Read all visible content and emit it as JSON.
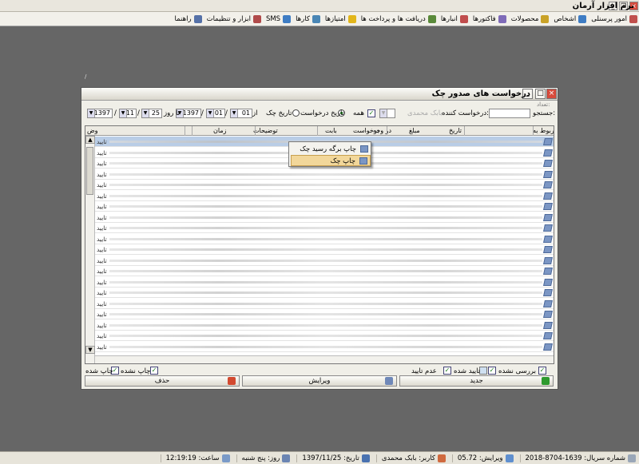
{
  "app": {
    "title": "نرم افزار آرمان"
  },
  "menu": [
    {
      "label": "امور پرسنلی",
      "color": "#c0504d"
    },
    {
      "label": "اشخاص",
      "color": "#3f7dc4"
    },
    {
      "label": "محصولات",
      "color": "#c9a227"
    },
    {
      "label": "فاکتورها",
      "color": "#7f6bb8"
    },
    {
      "label": "انبارها",
      "color": "#c04d4d"
    },
    {
      "label": "دریافت ها و پرداخت ها",
      "color": "#5a8a3a"
    },
    {
      "label": "امتیازها",
      "color": "#e2b61b"
    },
    {
      "label": "کارها",
      "color": "#4a86b5"
    },
    {
      "label": "SMS",
      "color": "#3f7dc4"
    },
    {
      "label": "ابزار و تنظیمات",
      "color": "#b04a4a"
    },
    {
      "label": "راهنما",
      "color": "#5571a8"
    }
  ],
  "window": {
    "title": "درخواست های صدور چک"
  },
  "filter": {
    "search_label": "جستجو:",
    "requester_label": "درخواست کننده:",
    "requester_value": "بابک محمدی",
    "count_label": "تعداد:",
    "all_label": "همه",
    "request_date_label": "تاریخ درخواست",
    "check_date_label": "تاریخ چک",
    "from_label": "از روز",
    "to_label": "تا روز",
    "from_day": "01",
    "from_month": "01",
    "from_year": "1397",
    "to_day": "25",
    "to_month": "11",
    "to_year": "1397"
  },
  "grid": {
    "columns": [
      "مربوط به",
      "تاریخ",
      "مبلغ",
      "در وجه",
      "درخواست",
      "بابت",
      "توضیحات",
      "زمان",
      "وض"
    ],
    "rows": [
      "تایید",
      "تایید",
      "تایید",
      "تایید",
      "تایید",
      "تایید",
      "تایید",
      "تایید",
      "تایید",
      "تایید",
      "تایید",
      "تایید",
      "تایید",
      "تایید",
      "تایید",
      "تایید",
      "تایید",
      "تایید",
      "تایید",
      "تایید"
    ]
  },
  "context_menu": {
    "items": [
      "چاپ برگه رسید چک",
      "چاپ چک"
    ]
  },
  "legend": {
    "not_reviewed": "بررسی نشده",
    "approved": "تایید شده",
    "not_approved": "عدم تایید",
    "not_printed": "چاپ نشده",
    "printed": "چاپ شده"
  },
  "buttons": {
    "new": "جدید",
    "edit": "ویرایش",
    "delete": "حذف"
  },
  "status": {
    "serial": "شماره سریال: 1639-8704-2018",
    "version": "ویرایش: 05.72",
    "user": "کاربر: بابک محمدی",
    "date": "تاریخ: 1397/11/25",
    "weekday": "روز: پنج شنبه",
    "time": "ساعت: 12:19:19"
  }
}
